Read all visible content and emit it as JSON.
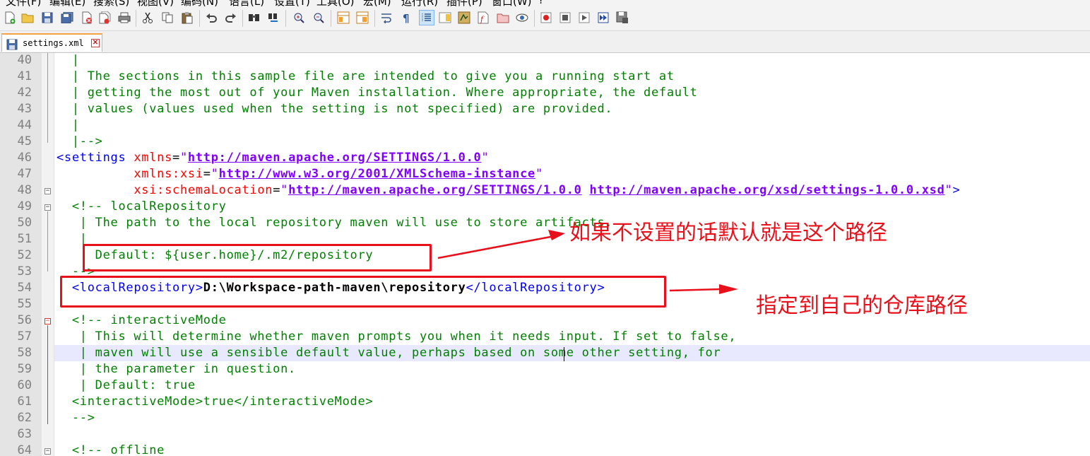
{
  "menu": [
    "文件(F)",
    "编辑(E)",
    "搜索(S)",
    "视图(V)",
    "编码(N)",
    "语言(L)",
    "设置(T)",
    "工具(O)",
    "宏(M)",
    "运行(R)",
    "插件(P)",
    "窗口(W)",
    "?"
  ],
  "tab": {
    "filename": "settings.xml",
    "close": "✕"
  },
  "colors": {
    "annotation": "#e8101a",
    "comment": "#008000",
    "tag": "#0000ff",
    "attribute": "#ff0000",
    "value": "#8000ff",
    "current_line": "#e8e8ff"
  },
  "lines": [
    {
      "num": "40",
      "segs": [
        {
          "t": "  |",
          "c": "cmt"
        }
      ]
    },
    {
      "num": "41",
      "segs": [
        {
          "t": "  | The sections in this sample file are intended to give you a running start at",
          "c": "cmt"
        }
      ]
    },
    {
      "num": "42",
      "segs": [
        {
          "t": "  | getting the most out of your Maven installation. Where appropriate, the default",
          "c": "cmt"
        }
      ]
    },
    {
      "num": "43",
      "segs": [
        {
          "t": "  | values (values used when the setting is not specified) are provided.",
          "c": "cmt"
        }
      ]
    },
    {
      "num": "44",
      "segs": [
        {
          "t": "  |",
          "c": "cmt"
        }
      ]
    },
    {
      "num": "45",
      "segs": [
        {
          "t": "  |-->",
          "c": "cmt"
        }
      ]
    },
    {
      "num": "46",
      "segs": [
        {
          "t": "<settings ",
          "c": "tag"
        },
        {
          "t": "xmlns",
          "c": "att"
        },
        {
          "t": "=",
          "c": "txt"
        },
        {
          "t": "\"",
          "c": "str"
        },
        {
          "t": "http://maven.apache.org/SETTINGS/1.0.0",
          "c": "url"
        },
        {
          "t": "\"",
          "c": "str"
        }
      ]
    },
    {
      "num": "47",
      "segs": [
        {
          "t": "          ",
          "c": "txt"
        },
        {
          "t": "xmlns:xsi",
          "c": "att"
        },
        {
          "t": "=",
          "c": "txt"
        },
        {
          "t": "\"",
          "c": "str"
        },
        {
          "t": "http://www.w3.org/2001/XMLSchema-instance",
          "c": "url"
        },
        {
          "t": "\"",
          "c": "str"
        }
      ]
    },
    {
      "num": "48",
      "segs": [
        {
          "t": "          ",
          "c": "txt"
        },
        {
          "t": "xsi:schemaLocation",
          "c": "att"
        },
        {
          "t": "=",
          "c": "txt"
        },
        {
          "t": "\"",
          "c": "str"
        },
        {
          "t": "http://maven.apache.org/SETTINGS/1.0.0",
          "c": "url"
        },
        {
          "t": " ",
          "c": "str"
        },
        {
          "t": "http://maven.apache.org/xsd/settings-1.0.0.xsd",
          "c": "url"
        },
        {
          "t": "\"",
          "c": "str"
        },
        {
          "t": ">",
          "c": "tag"
        }
      ]
    },
    {
      "num": "49",
      "segs": [
        {
          "t": "  <!-- localRepository",
          "c": "cmt"
        }
      ]
    },
    {
      "num": "50",
      "segs": [
        {
          "t": "   | The path to the local repository maven will use to store artifacts.",
          "c": "cmt"
        }
      ]
    },
    {
      "num": "51",
      "segs": [
        {
          "t": "   |",
          "c": "cmt"
        }
      ]
    },
    {
      "num": "52",
      "segs": [
        {
          "t": "   | Default: ${user.home}/.m2/repository",
          "c": "cmt"
        }
      ]
    },
    {
      "num": "53",
      "segs": [
        {
          "t": "  -->",
          "c": "cmt"
        }
      ]
    },
    {
      "num": "54",
      "segs": [
        {
          "t": "  <localRepository>",
          "c": "tag"
        },
        {
          "t": "D:\\Workspace-path-maven\\repository",
          "c": "txtb"
        },
        {
          "t": "</localRepository>",
          "c": "tag"
        }
      ]
    },
    {
      "num": "55",
      "segs": []
    },
    {
      "num": "56",
      "segs": [
        {
          "t": "  <!-- interactiveMode",
          "c": "cmt"
        }
      ]
    },
    {
      "num": "57",
      "segs": [
        {
          "t": "   | This will determine whether maven prompts you when it needs input. If set to false,",
          "c": "cmt"
        }
      ]
    },
    {
      "num": "58",
      "segs": [
        {
          "t": "   | maven will use a sensible default value, perhaps based on some other setting, for",
          "c": "cmt"
        }
      ]
    },
    {
      "num": "59",
      "segs": [
        {
          "t": "   | the parameter in question.",
          "c": "cmt"
        }
      ]
    },
    {
      "num": "60",
      "segs": [
        {
          "t": "   | Default: true",
          "c": "cmt"
        }
      ]
    },
    {
      "num": "61",
      "segs": [
        {
          "t": "  <interactiveMode>true</interactiveMode>",
          "c": "cmt"
        }
      ]
    },
    {
      "num": "62",
      "segs": [
        {
          "t": "  -->",
          "c": "cmt"
        }
      ]
    },
    {
      "num": "63",
      "segs": []
    },
    {
      "num": "64",
      "segs": [
        {
          "t": "  <!-- offline",
          "c": "cmt"
        }
      ]
    }
  ],
  "annotations": {
    "default_path": "如果不设置的话默认就是这个路径",
    "custom_repo": "指定到自己的仓库路径"
  }
}
